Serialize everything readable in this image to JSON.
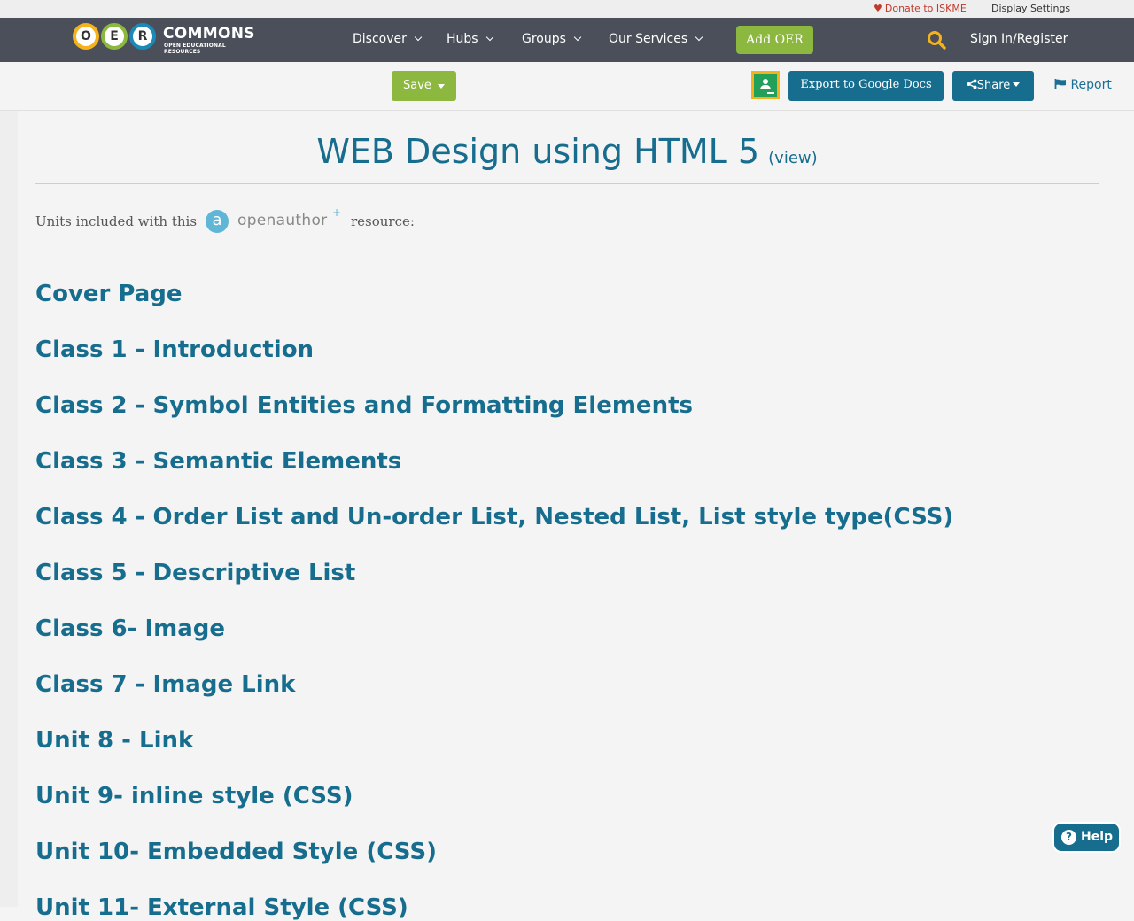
{
  "utility": {
    "donate": "Donate to ISKME",
    "display_settings": "Display Settings"
  },
  "nav": {
    "logo_word": "COMMONS",
    "logo_sub": "OPEN EDUCATIONAL RESOURCES",
    "logo_letters": [
      "O",
      "E",
      "R"
    ],
    "items": [
      {
        "label": "Discover"
      },
      {
        "label": "Hubs"
      },
      {
        "label": "Groups"
      },
      {
        "label": "Our Services"
      }
    ],
    "add_oer": "Add OER",
    "sign_in": "Sign In/Register"
  },
  "actions": {
    "save": "Save",
    "export": "Export to Google Docs",
    "share": "Share",
    "report": "Report"
  },
  "main": {
    "title": "WEB Design using HTML 5",
    "view": "(view)",
    "units_label": "Units included with this",
    "openauthor": {
      "letter": "a",
      "text": "openauthor",
      "plus": "+"
    },
    "resource_label": "resource:",
    "units": [
      "Cover Page",
      "Class 1 - Introduction",
      "Class 2 - Symbol Entities and Formatting Elements",
      "Class 3 - Semantic Elements",
      "Class 4 - Order List and Un-order List, Nested List, List style type(CSS)",
      "Class 5 - Descriptive List",
      "Class 6- Image",
      "Class 7 - Image Link",
      "Unit 8 - Link",
      "Unit 9- inline style (CSS)",
      "Unit 10- Embedded Style (CSS)",
      "Unit 11- External Style (CSS)"
    ]
  },
  "help": {
    "label": "Help",
    "icon": "?"
  },
  "colors": {
    "accent_blue": "#176d8e",
    "accent_green": "#8cb83f",
    "nav_bg": "#4b4f59",
    "search_icon": "#f5b21b"
  }
}
